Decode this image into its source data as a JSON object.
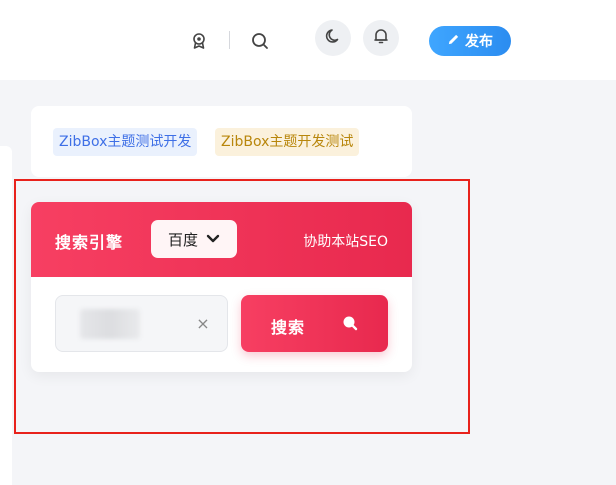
{
  "header": {
    "icons": [
      "badge-icon",
      "search-icon",
      "moon-icon",
      "bell-icon",
      "pencil-icon"
    ],
    "publish_label": "发布"
  },
  "tags": [
    "ZibBox主题测试开发",
    "ZibBox主题开发测试"
  ],
  "search_widget": {
    "title": "搜索引擎",
    "engine": "百度",
    "assist_link": "协助本站SEO",
    "input_value": "",
    "clear_symbol": "×",
    "submit_label": "搜索"
  },
  "colors": {
    "accent": "#f73f62",
    "accent_dark": "#e8294e",
    "publish": "#2b8cf0",
    "tag_blue": "#3e6fe6",
    "tag_gold": "#b8860b",
    "annotation_red": "#e8221c"
  }
}
